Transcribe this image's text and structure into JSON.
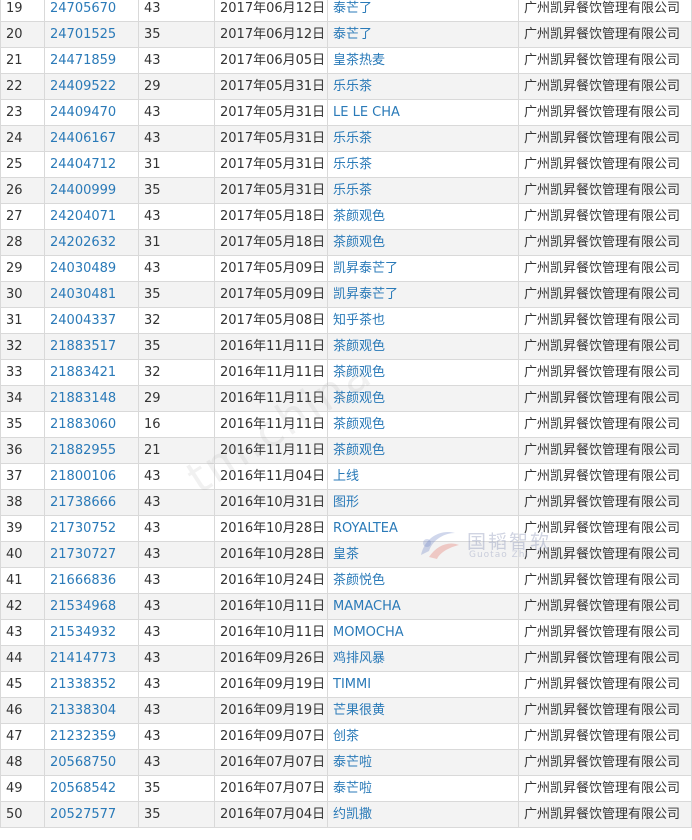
{
  "table": {
    "rows": [
      {
        "idx": "19",
        "reg": "24705670",
        "cls": "43",
        "date": "2017年06月12日",
        "name": "泰芒了",
        "applicant": "广州凯昇餐饮管理有限公司"
      },
      {
        "idx": "20",
        "reg": "24701525",
        "cls": "35",
        "date": "2017年06月12日",
        "name": "泰芒了",
        "applicant": "广州凯昇餐饮管理有限公司"
      },
      {
        "idx": "21",
        "reg": "24471859",
        "cls": "43",
        "date": "2017年06月05日",
        "name": "皇茶热麦",
        "applicant": "广州凯昇餐饮管理有限公司"
      },
      {
        "idx": "22",
        "reg": "24409522",
        "cls": "29",
        "date": "2017年05月31日",
        "name": "乐乐茶",
        "applicant": "广州凯昇餐饮管理有限公司"
      },
      {
        "idx": "23",
        "reg": "24409470",
        "cls": "43",
        "date": "2017年05月31日",
        "name": "LE LE CHA",
        "applicant": "广州凯昇餐饮管理有限公司"
      },
      {
        "idx": "24",
        "reg": "24406167",
        "cls": "43",
        "date": "2017年05月31日",
        "name": "乐乐茶",
        "applicant": "广州凯昇餐饮管理有限公司"
      },
      {
        "idx": "25",
        "reg": "24404712",
        "cls": "31",
        "date": "2017年05月31日",
        "name": "乐乐茶",
        "applicant": "广州凯昇餐饮管理有限公司"
      },
      {
        "idx": "26",
        "reg": "24400999",
        "cls": "35",
        "date": "2017年05月31日",
        "name": "乐乐茶",
        "applicant": "广州凯昇餐饮管理有限公司"
      },
      {
        "idx": "27",
        "reg": "24204071",
        "cls": "43",
        "date": "2017年05月18日",
        "name": "茶颜观色",
        "applicant": "广州凯昇餐饮管理有限公司"
      },
      {
        "idx": "28",
        "reg": "24202632",
        "cls": "31",
        "date": "2017年05月18日",
        "name": "茶颜观色",
        "applicant": "广州凯昇餐饮管理有限公司"
      },
      {
        "idx": "29",
        "reg": "24030489",
        "cls": "43",
        "date": "2017年05月09日",
        "name": "凯昇泰芒了",
        "applicant": "广州凯昇餐饮管理有限公司"
      },
      {
        "idx": "30",
        "reg": "24030481",
        "cls": "35",
        "date": "2017年05月09日",
        "name": "凯昇泰芒了",
        "applicant": "广州凯昇餐饮管理有限公司"
      },
      {
        "idx": "31",
        "reg": "24004337",
        "cls": "32",
        "date": "2017年05月08日",
        "name": "知乎茶也",
        "applicant": "广州凯昇餐饮管理有限公司"
      },
      {
        "idx": "32",
        "reg": "21883517",
        "cls": "35",
        "date": "2016年11月11日",
        "name": "茶颜观色",
        "applicant": "广州凯昇餐饮管理有限公司"
      },
      {
        "idx": "33",
        "reg": "21883421",
        "cls": "32",
        "date": "2016年11月11日",
        "name": "茶颜观色",
        "applicant": "广州凯昇餐饮管理有限公司"
      },
      {
        "idx": "34",
        "reg": "21883148",
        "cls": "29",
        "date": "2016年11月11日",
        "name": "茶颜观色",
        "applicant": "广州凯昇餐饮管理有限公司"
      },
      {
        "idx": "35",
        "reg": "21883060",
        "cls": "16",
        "date": "2016年11月11日",
        "name": "茶颜观色",
        "applicant": "广州凯昇餐饮管理有限公司"
      },
      {
        "idx": "36",
        "reg": "21882955",
        "cls": "21",
        "date": "2016年11月11日",
        "name": "茶颜观色",
        "applicant": "广州凯昇餐饮管理有限公司"
      },
      {
        "idx": "37",
        "reg": "21800106",
        "cls": "43",
        "date": "2016年11月04日",
        "name": "上线",
        "applicant": "广州凯昇餐饮管理有限公司"
      },
      {
        "idx": "38",
        "reg": "21738666",
        "cls": "43",
        "date": "2016年10月31日",
        "name": "图形",
        "applicant": "广州凯昇餐饮管理有限公司"
      },
      {
        "idx": "39",
        "reg": "21730752",
        "cls": "43",
        "date": "2016年10月28日",
        "name": "ROYALTEA",
        "applicant": "广州凯昇餐饮管理有限公司"
      },
      {
        "idx": "40",
        "reg": "21730727",
        "cls": "43",
        "date": "2016年10月28日",
        "name": "皇茶",
        "applicant": "广州凯昇餐饮管理有限公司"
      },
      {
        "idx": "41",
        "reg": "21666836",
        "cls": "43",
        "date": "2016年10月24日",
        "name": "茶颜悦色",
        "applicant": "广州凯昇餐饮管理有限公司"
      },
      {
        "idx": "42",
        "reg": "21534968",
        "cls": "43",
        "date": "2016年10月11日",
        "name": "MAMACHA",
        "applicant": "广州凯昇餐饮管理有限公司"
      },
      {
        "idx": "43",
        "reg": "21534932",
        "cls": "43",
        "date": "2016年10月11日",
        "name": "MOMOCHA",
        "applicant": "广州凯昇餐饮管理有限公司"
      },
      {
        "idx": "44",
        "reg": "21414773",
        "cls": "43",
        "date": "2016年09月26日",
        "name": "鸡排风暴",
        "applicant": "广州凯昇餐饮管理有限公司"
      },
      {
        "idx": "45",
        "reg": "21338352",
        "cls": "43",
        "date": "2016年09月19日",
        "name": "TIMMI",
        "applicant": "广州凯昇餐饮管理有限公司"
      },
      {
        "idx": "46",
        "reg": "21338304",
        "cls": "43",
        "date": "2016年09月19日",
        "name": "芒果很黄",
        "applicant": "广州凯昇餐饮管理有限公司"
      },
      {
        "idx": "47",
        "reg": "21232359",
        "cls": "43",
        "date": "2016年09月07日",
        "name": "创茶",
        "applicant": "广州凯昇餐饮管理有限公司"
      },
      {
        "idx": "48",
        "reg": "20568750",
        "cls": "43",
        "date": "2016年07月07日",
        "name": "泰芒啦",
        "applicant": "广州凯昇餐饮管理有限公司"
      },
      {
        "idx": "49",
        "reg": "20568542",
        "cls": "35",
        "date": "2016年07月07日",
        "name": "泰芒啦",
        "applicant": "广州凯昇餐饮管理有限公司"
      },
      {
        "idx": "50",
        "reg": "20527577",
        "cls": "35",
        "date": "2016年07月04日",
        "name": "约凯撒",
        "applicant": "广州凯昇餐饮管理有限公司"
      }
    ]
  },
  "watermark": {
    "diagonal_text": "tm.china",
    "logo_cn": "国韬智软",
    "logo_en": "Guotao Zhi",
    "logo_icon": "swirl-logo-icon"
  },
  "colors": {
    "link": "#2a7ab8",
    "row_alt": "#f3f3f3",
    "border": "#d9d9d9",
    "text": "#333333"
  }
}
